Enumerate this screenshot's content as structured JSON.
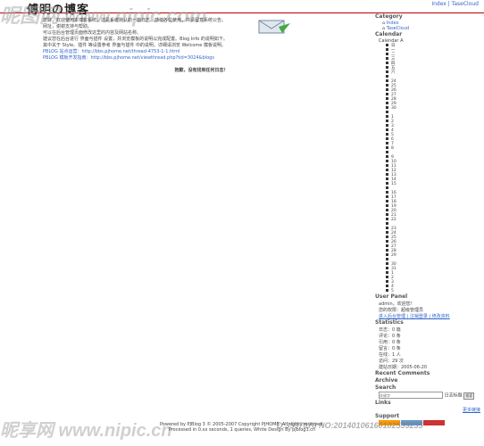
{
  "header": {
    "title": "傅明の博客",
    "subtitle": "傅明の博客",
    "links": "Index | TaseCloud"
  },
  "post": {
    "lines": [
      "您好，欢迎使用本博客系统，这是系统默认的一篇日志。感谢各位使用，并请留意系统公告。",
      "网址，谢谢支持与帮助。",
      "可以在后台管理页面修改这里的内容及网站名称。",
      "建议您在后台进行 界面与插件 设置，并浏览模板的说明以完成配置。Blog Info 的说明如下。",
      "其中关于 Style、插件 等设置参考 界面与插件 中的说明，详细请浏览 Welcome 模板说明。",
      "PBLOG 站点运营：http://bbs.pjhome.net/thread-4753-1-1.html",
      "PBLOG 模板开发指南：http://bbs.pjhome.net/viewthread.php?tid=3024&blogs"
    ],
    "footer": "抱歉，没有找到任何日志！"
  },
  "sidebar": {
    "category": {
      "title": "Category",
      "items": [
        "Index",
        "TaseCloud"
      ]
    },
    "calendar": {
      "title": "Calendar",
      "month": "Calendar A",
      "days": [
        "日",
        "一",
        "二",
        "三",
        "四",
        "五",
        "六",
        "",
        "24",
        "25",
        "26",
        "27",
        "28",
        "29",
        "30",
        "",
        "1",
        "2",
        "3",
        "4",
        "5",
        "6",
        "7",
        "8",
        "",
        "9",
        "10",
        "11",
        "12",
        "13",
        "14",
        "15",
        "",
        "16",
        "17",
        "18",
        "19",
        "20",
        "21",
        "22",
        "",
        "23",
        "24",
        "25",
        "26",
        "27",
        "28",
        "29",
        "",
        "30",
        "31",
        "1",
        "2",
        "3",
        "4",
        "5"
      ]
    },
    "userpanel": {
      "title": "User Panel",
      "line1": "admin，欢迎您！",
      "line2": "您的权限：超级管理员",
      "link": "进入后台管理 | 注销登录 | 修改资料"
    },
    "stats": {
      "title": "Statistics",
      "rows": [
        "日志：0 篇",
        "评论：0 条",
        "引用：0 条",
        "留言：0 条",
        "在线：1 人",
        "访问：29 次",
        "建站日期：2005-06-20"
      ]
    },
    "recent": {
      "title": "Recent Comments"
    },
    "archive": {
      "title": "Archive"
    },
    "search": {
      "title": "Search",
      "placeholder": "关键字",
      "go": "搜索",
      "opt": "日志标题"
    },
    "links": {
      "title": "Links",
      "more": "更多链接"
    },
    "support": {
      "title": "Support"
    }
  },
  "footer": {
    "line1": "Powered by PJBlog 3 © 2005-2007 Copyright PJHOME. All rights reserved.",
    "line2": "Processed in 0.xx seconds, 1 queries, White Design By pjblog3.cn"
  },
  "watermarks": {
    "top": "昵图网 www.nipic.com",
    "bottom": "昵享网 www.nipic.cn",
    "id": "D:3597078 NO:20140106160102539235"
  }
}
